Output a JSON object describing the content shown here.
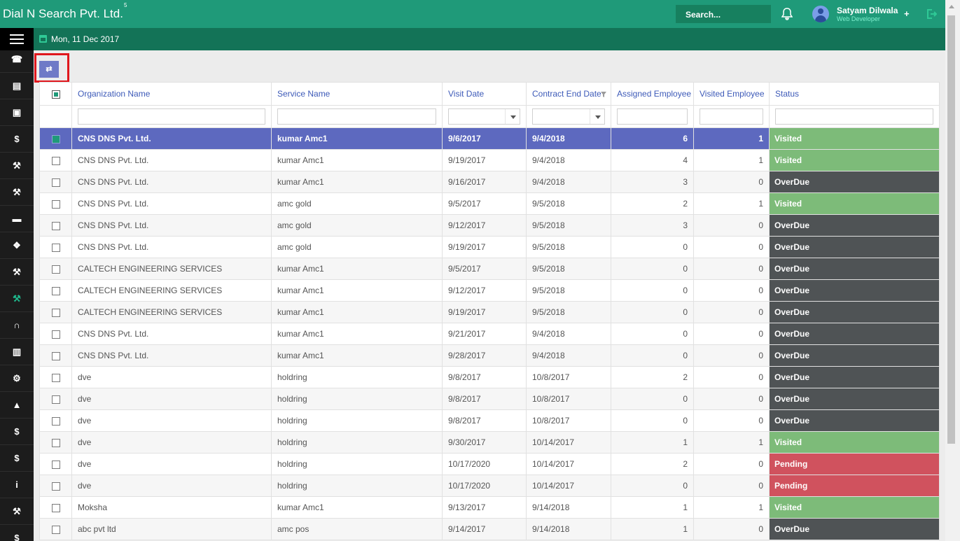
{
  "app": {
    "brand": "Dial N Search Pvt. Ltd.",
    "brand_sup": "5",
    "search_placeholder": "Search...",
    "user_name": "Satyam Dilwala",
    "user_role": "Web Developer",
    "date": "Mon, 11 Dec 2017"
  },
  "sidebar": {
    "items": [
      {
        "icon": "phone-icon",
        "glyph": "☎"
      },
      {
        "icon": "basket-icon",
        "glyph": "▤"
      },
      {
        "icon": "pdf-icon",
        "glyph": "▣"
      },
      {
        "icon": "dollar-icon",
        "glyph": "$"
      },
      {
        "icon": "gavel-icon",
        "glyph": "⚒"
      },
      {
        "icon": "gavel-icon",
        "glyph": "⚒"
      },
      {
        "icon": "truck-icon",
        "glyph": "▬"
      },
      {
        "icon": "puzzle-icon",
        "glyph": "❖"
      },
      {
        "icon": "wrench-icon",
        "glyph": "⚒"
      },
      {
        "icon": "wrench-icon",
        "glyph": "⚒",
        "active": true
      },
      {
        "icon": "headset-icon",
        "glyph": "∩"
      },
      {
        "icon": "industry-icon",
        "glyph": "▥"
      },
      {
        "icon": "cogs-icon",
        "glyph": "⚙"
      },
      {
        "icon": "user-icon",
        "glyph": "▲"
      },
      {
        "icon": "dollar-icon",
        "glyph": "$"
      },
      {
        "icon": "dollar-icon",
        "glyph": "$"
      },
      {
        "icon": "info-icon",
        "glyph": "i"
      },
      {
        "icon": "wrench-icon",
        "glyph": "⚒"
      },
      {
        "icon": "dollar-icon",
        "glyph": "$"
      }
    ]
  },
  "grid": {
    "columns": [
      "Organization Name",
      "Service Name",
      "Visit Date",
      "Contract End Date",
      "Assigned Employee",
      "Visited Employee",
      "Status"
    ],
    "rows": [
      {
        "org": "CNS DNS Pvt. Ltd.",
        "service": "kumar Amc1",
        "visit": "9/6/2017",
        "end": "9/4/2018",
        "assigned": "6",
        "visited": "1",
        "status": "Visited",
        "selected": true
      },
      {
        "org": "CNS DNS Pvt. Ltd.",
        "service": "kumar Amc1",
        "visit": "9/19/2017",
        "end": "9/4/2018",
        "assigned": "4",
        "visited": "1",
        "status": "Visited"
      },
      {
        "org": "CNS DNS Pvt. Ltd.",
        "service": "kumar Amc1",
        "visit": "9/16/2017",
        "end": "9/4/2018",
        "assigned": "3",
        "visited": "0",
        "status": "OverDue"
      },
      {
        "org": "CNS DNS Pvt. Ltd.",
        "service": "amc gold",
        "visit": "9/5/2017",
        "end": "9/5/2018",
        "assigned": "2",
        "visited": "1",
        "status": "Visited"
      },
      {
        "org": "CNS DNS Pvt. Ltd.",
        "service": "amc gold",
        "visit": "9/12/2017",
        "end": "9/5/2018",
        "assigned": "3",
        "visited": "0",
        "status": "OverDue"
      },
      {
        "org": "CNS DNS Pvt. Ltd.",
        "service": "amc gold",
        "visit": "9/19/2017",
        "end": "9/5/2018",
        "assigned": "0",
        "visited": "0",
        "status": "OverDue"
      },
      {
        "org": "CALTECH ENGINEERING SERVICES",
        "service": "kumar Amc1",
        "visit": "9/5/2017",
        "end": "9/5/2018",
        "assigned": "0",
        "visited": "0",
        "status": "OverDue"
      },
      {
        "org": "CALTECH ENGINEERING SERVICES",
        "service": "kumar Amc1",
        "visit": "9/12/2017",
        "end": "9/5/2018",
        "assigned": "0",
        "visited": "0",
        "status": "OverDue"
      },
      {
        "org": "CALTECH ENGINEERING SERVICES",
        "service": "kumar Amc1",
        "visit": "9/19/2017",
        "end": "9/5/2018",
        "assigned": "0",
        "visited": "0",
        "status": "OverDue"
      },
      {
        "org": "CNS DNS Pvt. Ltd.",
        "service": "kumar Amc1",
        "visit": "9/21/2017",
        "end": "9/4/2018",
        "assigned": "0",
        "visited": "0",
        "status": "OverDue"
      },
      {
        "org": "CNS DNS Pvt. Ltd.",
        "service": "kumar Amc1",
        "visit": "9/28/2017",
        "end": "9/4/2018",
        "assigned": "0",
        "visited": "0",
        "status": "OverDue"
      },
      {
        "org": "dve",
        "service": "holdring",
        "visit": "9/8/2017",
        "end": "10/8/2017",
        "assigned": "2",
        "visited": "0",
        "status": "OverDue"
      },
      {
        "org": "dve",
        "service": "holdring",
        "visit": "9/8/2017",
        "end": "10/8/2017",
        "assigned": "0",
        "visited": "0",
        "status": "OverDue"
      },
      {
        "org": "dve",
        "service": "holdring",
        "visit": "9/8/2017",
        "end": "10/8/2017",
        "assigned": "0",
        "visited": "0",
        "status": "OverDue"
      },
      {
        "org": "dve",
        "service": "holdring",
        "visit": "9/30/2017",
        "end": "10/14/2017",
        "assigned": "1",
        "visited": "1",
        "status": "Visited"
      },
      {
        "org": "dve",
        "service": "holdring",
        "visit": "10/17/2020",
        "end": "10/14/2017",
        "assigned": "2",
        "visited": "0",
        "status": "Pending"
      },
      {
        "org": "dve",
        "service": "holdring",
        "visit": "10/17/2020",
        "end": "10/14/2017",
        "assigned": "0",
        "visited": "0",
        "status": "Pending"
      },
      {
        "org": "Moksha",
        "service": "kumar Amc1",
        "visit": "9/13/2017",
        "end": "9/14/2018",
        "assigned": "1",
        "visited": "1",
        "status": "Visited"
      },
      {
        "org": "abc pvt ltd",
        "service": "amc pos",
        "visit": "9/14/2017",
        "end": "9/14/2018",
        "assigned": "1",
        "visited": "0",
        "status": "OverDue"
      }
    ]
  },
  "colors": {
    "topbar": "#1f9a79",
    "subbar": "#137357",
    "selected_row": "#5d69bf",
    "visited": "#7dbb79",
    "overdue": "#4f5355",
    "pending": "#d0525e"
  }
}
